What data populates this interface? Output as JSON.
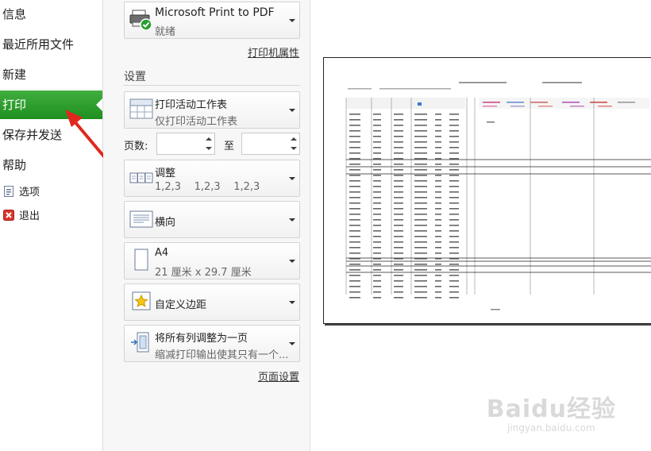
{
  "nav": {
    "items": [
      {
        "label": "信息"
      },
      {
        "label": "最近所用文件"
      },
      {
        "label": "新建"
      },
      {
        "label": "打印"
      },
      {
        "label": "保存并发送"
      },
      {
        "label": "帮助"
      }
    ],
    "small_items": [
      {
        "label": "选项"
      },
      {
        "label": "退出"
      }
    ],
    "active_color": "#2e9e2e"
  },
  "printer": {
    "name": "Microsoft Print to PDF",
    "status": "就绪",
    "properties_link": "打印机属性"
  },
  "settings": {
    "heading": "设置",
    "scope": {
      "title": "打印活动工作表",
      "subtitle": "仅打印活动工作表"
    },
    "pages": {
      "label": "页数:",
      "to_label": "至",
      "from_value": "",
      "to_value": ""
    },
    "collate": {
      "title": "调整",
      "subtitle": "1,2,3    1,2,3    1,2,3"
    },
    "orientation": {
      "title": "横向"
    },
    "paper": {
      "title": "A4",
      "subtitle": "21 厘米 x 29.7 厘米"
    },
    "margins": {
      "title": "自定义边距"
    },
    "scaling": {
      "title": "将所有列调整为一页",
      "subtitle": "缩减打印输出使其只有一个..."
    },
    "page_setup_link": "页面设置"
  },
  "watermark": {
    "line1": "Baidu经验",
    "line2": "jingyan.baidu.com"
  }
}
